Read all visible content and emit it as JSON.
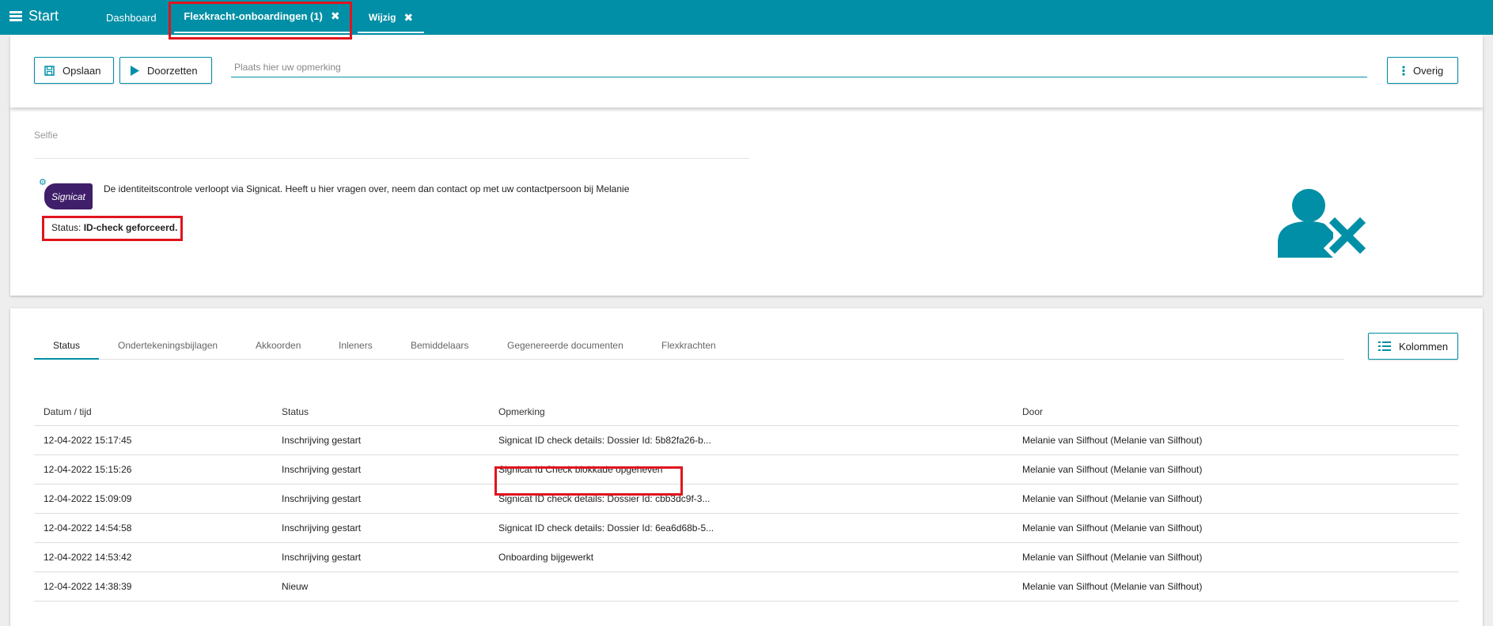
{
  "topbar": {
    "start_label": "Start",
    "tabs": [
      {
        "label": "Dashboard"
      },
      {
        "label": "Flexkracht-onboardingen (1)"
      },
      {
        "label": "Wijzig"
      }
    ]
  },
  "toolbar": {
    "save_label": "Opslaan",
    "forward_label": "Doorzetten",
    "remark_placeholder": "Plaats hier uw opmerking",
    "more_label": "Overig"
  },
  "selfie": {
    "section_label": "Selfie",
    "logo_text": "Signicat",
    "info_text": "De identiteitscontrole verloopt via Signicat. Heeft u hier vragen over, neem dan contact op met uw contactpersoon bij Melanie",
    "status_prefix": "Status:",
    "status_value": "ID-check geforceerd."
  },
  "tabs": {
    "items": [
      {
        "label": "Status"
      },
      {
        "label": "Ondertekeningsbijlagen"
      },
      {
        "label": "Akkoorden"
      },
      {
        "label": "Inleners"
      },
      {
        "label": "Bemiddelaars"
      },
      {
        "label": "Gegenereerde documenten"
      },
      {
        "label": "Flexkrachten"
      }
    ],
    "columns_label": "Kolommen"
  },
  "table": {
    "headers": [
      "Datum / tijd",
      "Status",
      "Opmerking",
      "Door"
    ],
    "rows": [
      [
        "12-04-2022 15:17:45",
        "Inschrijving gestart",
        "Signicat ID check details: Dossier Id: 5b82fa26-b...",
        "Melanie van Silfhout (Melanie van Silfhout)"
      ],
      [
        "12-04-2022 15:15:26",
        "Inschrijving gestart",
        "Signicat Id Check blokkade opgeheven",
        "Melanie van Silfhout (Melanie van Silfhout)"
      ],
      [
        "12-04-2022 15:09:09",
        "Inschrijving gestart",
        "Signicat ID check details: Dossier Id: cbb3dc9f-3...",
        "Melanie van Silfhout (Melanie van Silfhout)"
      ],
      [
        "12-04-2022 14:54:58",
        "Inschrijving gestart",
        "Signicat ID check details: Dossier Id: 6ea6d68b-5...",
        "Melanie van Silfhout (Melanie van Silfhout)"
      ],
      [
        "12-04-2022 14:53:42",
        "Inschrijving gestart",
        "Onboarding bijgewerkt",
        "Melanie van Silfhout (Melanie van Silfhout)"
      ],
      [
        "12-04-2022 14:38:39",
        "Nieuw",
        "",
        "Melanie van Silfhout (Melanie van Silfhout)"
      ]
    ]
  },
  "colors": {
    "accent": "#008fa6",
    "highlight": "#e0141e",
    "signicat": "#3f1e6a"
  },
  "icons": [
    "menu-icon",
    "close-icon",
    "save-icon",
    "play-icon",
    "more-vertical-icon",
    "gear-icon",
    "user-remove-icon",
    "list-icon"
  ]
}
